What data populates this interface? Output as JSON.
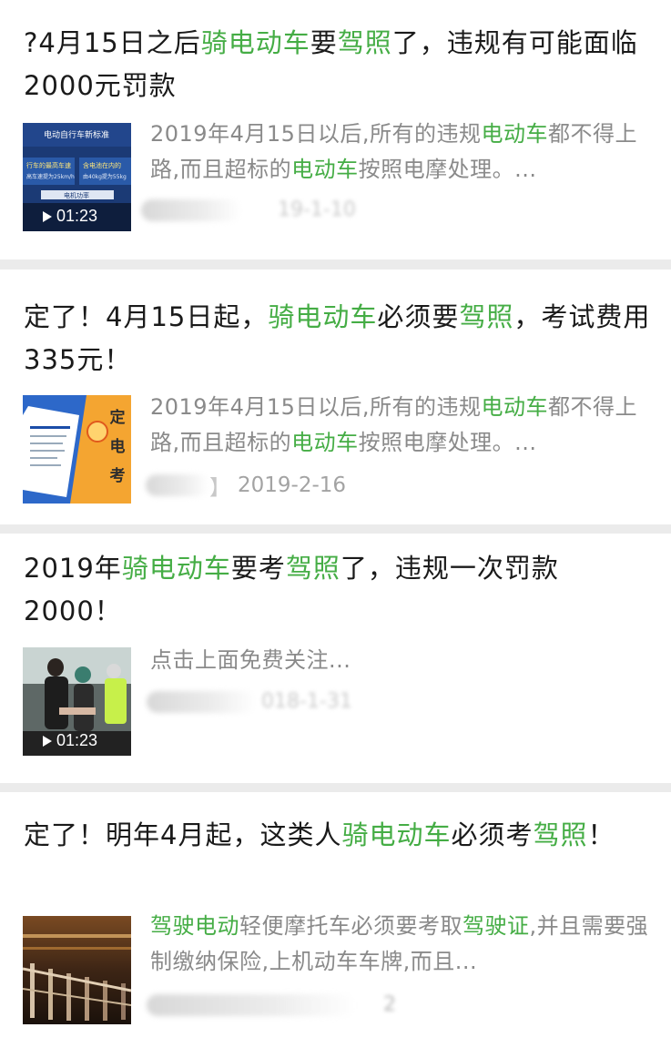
{
  "articles": [
    {
      "title_parts": [
        {
          "text": "?4月15日之后",
          "hl": false
        },
        {
          "text": "骑电动车",
          "hl": true
        },
        {
          "text": "要",
          "hl": false
        },
        {
          "text": "驾照",
          "hl": true
        },
        {
          "text": "了，违规有可能面临2000元罚款",
          "hl": false
        }
      ],
      "summary_parts": [
        {
          "text": "2019年4月15日以后,所有的违规",
          "hl": false
        },
        {
          "text": "电动车",
          "hl": true
        },
        {
          "text": "都不得上路,而且超标的",
          "hl": false
        },
        {
          "text": "电动车",
          "hl": true
        },
        {
          "text": "按照电摩处理。...",
          "hl": false
        }
      ],
      "thumb": {
        "kind": "video",
        "duration": "01:23",
        "banner_text": "电动自行车新标准",
        "left_text": "行车的最高车速",
        "right_text": "含电池在内的",
        "left_sub": "高车速提为25km/h",
        "right_sub": "由40kg提为55kg",
        "bottom_text": "电机功率"
      },
      "date": "19-1-10"
    },
    {
      "title_parts": [
        {
          "text": "定了！4月15日起，",
          "hl": false
        },
        {
          "text": "骑电动车",
          "hl": true
        },
        {
          "text": "必须要",
          "hl": false
        },
        {
          "text": "驾照",
          "hl": true
        },
        {
          "text": "，考试费用335元！",
          "hl": false
        }
      ],
      "summary_parts": [
        {
          "text": "2019年4月15日以后,所有的违规",
          "hl": false
        },
        {
          "text": "电动车",
          "hl": true
        },
        {
          "text": "都不得上路,而且超标的",
          "hl": false
        },
        {
          "text": "电动车",
          "hl": true
        },
        {
          "text": "按照电摩处理。...",
          "hl": false
        }
      ],
      "thumb": {
        "kind": "poster",
        "chars": [
          "定",
          "电",
          "考"
        ]
      },
      "date": "2019-2-16",
      "date_prefix": "】"
    },
    {
      "title_parts": [
        {
          "text": "2019年",
          "hl": false
        },
        {
          "text": "骑电动车",
          "hl": true
        },
        {
          "text": "要考",
          "hl": false
        },
        {
          "text": "驾照",
          "hl": true
        },
        {
          "text": "了，违规一次罚款2000！",
          "hl": false
        }
      ],
      "summary_parts": [
        {
          "text": "点击上面免费关注...",
          "hl": false
        }
      ],
      "thumb": {
        "kind": "video-photo",
        "duration": "01:23"
      },
      "date": "018-1-31"
    },
    {
      "title_parts": [
        {
          "text": "定了！明年4月起，这类人",
          "hl": false
        },
        {
          "text": "骑电动车",
          "hl": true
        },
        {
          "text": "必须考",
          "hl": false
        },
        {
          "text": "驾照",
          "hl": true
        },
        {
          "text": "！",
          "hl": false
        }
      ],
      "summary_parts": [
        {
          "text": "驾驶电动",
          "hl": true
        },
        {
          "text": "轻便摩托车必须要考取",
          "hl": false
        },
        {
          "text": "驾驶证",
          "hl": true
        },
        {
          "text": ",并且需要强制缴纳保险,上机动车车牌,而且...",
          "hl": false
        }
      ],
      "thumb": {
        "kind": "night-photo"
      },
      "date": "2"
    }
  ],
  "colors": {
    "highlight": "#45ad45",
    "title": "#1a1a1a",
    "summary": "#8a8a8a",
    "meta": "#a3a3a3",
    "separator": "#ebebeb"
  }
}
